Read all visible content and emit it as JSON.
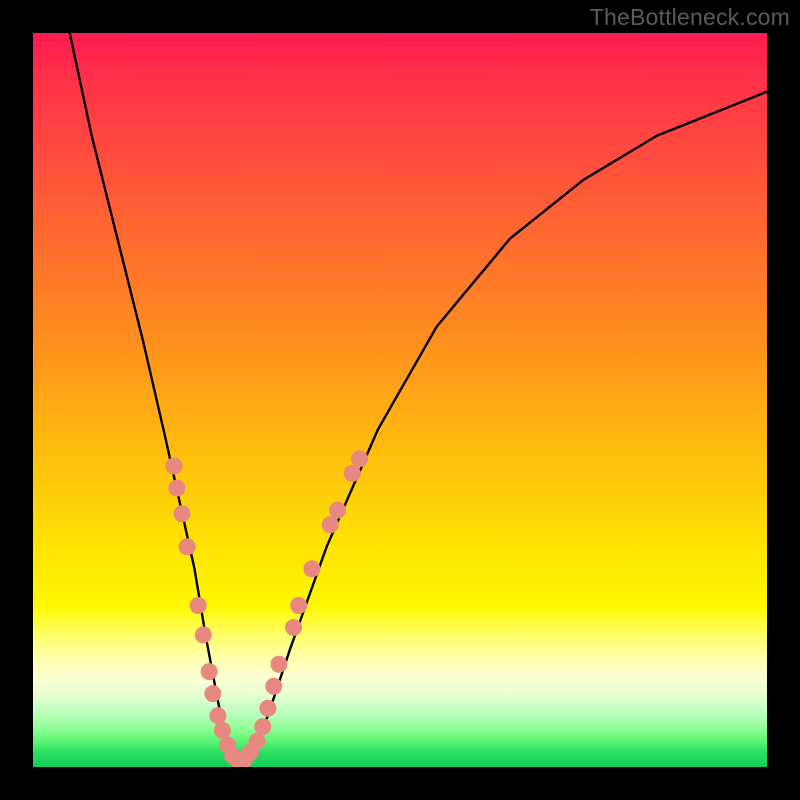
{
  "watermark": {
    "text": "TheBottleneck.com"
  },
  "chart_data": {
    "type": "line",
    "title": "",
    "xlabel": "",
    "ylabel": "",
    "xlim": [
      0,
      100
    ],
    "ylim": [
      0,
      100
    ],
    "series": [
      {
        "name": "bottleneck-curve",
        "x": [
          5,
          8,
          12,
          15,
          18,
          20,
          22,
          23.5,
          25,
          26,
          27,
          28.5,
          30,
          32,
          35,
          40,
          47,
          55,
          65,
          75,
          85,
          95,
          100
        ],
        "y": [
          100,
          86,
          70,
          58,
          45,
          36,
          27,
          18,
          10,
          5,
          2,
          0.5,
          2,
          7,
          16,
          30,
          46,
          60,
          72,
          80,
          86,
          90,
          92
        ]
      }
    ],
    "markers": [
      {
        "x": 19.2,
        "y": 41
      },
      {
        "x": 19.6,
        "y": 38
      },
      {
        "x": 20.3,
        "y": 34.5
      },
      {
        "x": 21.0,
        "y": 30
      },
      {
        "x": 22.5,
        "y": 22
      },
      {
        "x": 23.2,
        "y": 18
      },
      {
        "x": 24.0,
        "y": 13
      },
      {
        "x": 24.5,
        "y": 10
      },
      {
        "x": 25.2,
        "y": 7
      },
      {
        "x": 25.8,
        "y": 5
      },
      {
        "x": 26.5,
        "y": 3
      },
      {
        "x": 27.2,
        "y": 1.5
      },
      {
        "x": 28.0,
        "y": 0.8
      },
      {
        "x": 28.8,
        "y": 1
      },
      {
        "x": 29.6,
        "y": 2
      },
      {
        "x": 30.5,
        "y": 3.5
      },
      {
        "x": 31.3,
        "y": 5.5
      },
      {
        "x": 32.0,
        "y": 8
      },
      {
        "x": 32.8,
        "y": 11
      },
      {
        "x": 33.5,
        "y": 14
      },
      {
        "x": 35.5,
        "y": 19
      },
      {
        "x": 36.2,
        "y": 22
      },
      {
        "x": 38.0,
        "y": 27
      },
      {
        "x": 40.5,
        "y": 33
      },
      {
        "x": 41.5,
        "y": 35
      },
      {
        "x": 43.5,
        "y": 40
      },
      {
        "x": 44.5,
        "y": 42
      }
    ],
    "colors": {
      "curve": "#000000",
      "marker_fill": "#e98781",
      "marker_stroke": "#c85a58"
    }
  }
}
